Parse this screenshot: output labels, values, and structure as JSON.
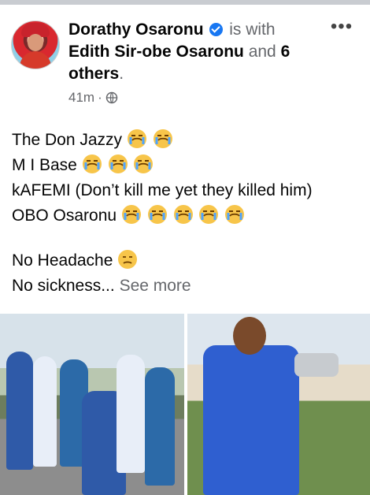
{
  "post": {
    "author": "Dorathy Osaronu",
    "is_with": "is with",
    "tagged_person": "Edith Sir-obe Osaronu",
    "and_text": "and",
    "others": "6 others",
    "period": ".",
    "time": "41m",
    "separator": "·",
    "more_icon": "more-options-icon",
    "globe_icon": "globe-icon",
    "accent": "#1877f2",
    "lines": [
      "The Don Jazzy",
      "M I Base",
      "kAFEMI (Don’t kill me yet they killed him)",
      "OBO Osaronu"
    ],
    "emoji_counts": [
      2,
      3,
      0,
      5
    ],
    "line2": "No Headache",
    "line3": "No sickness...",
    "see_more": "See more"
  }
}
